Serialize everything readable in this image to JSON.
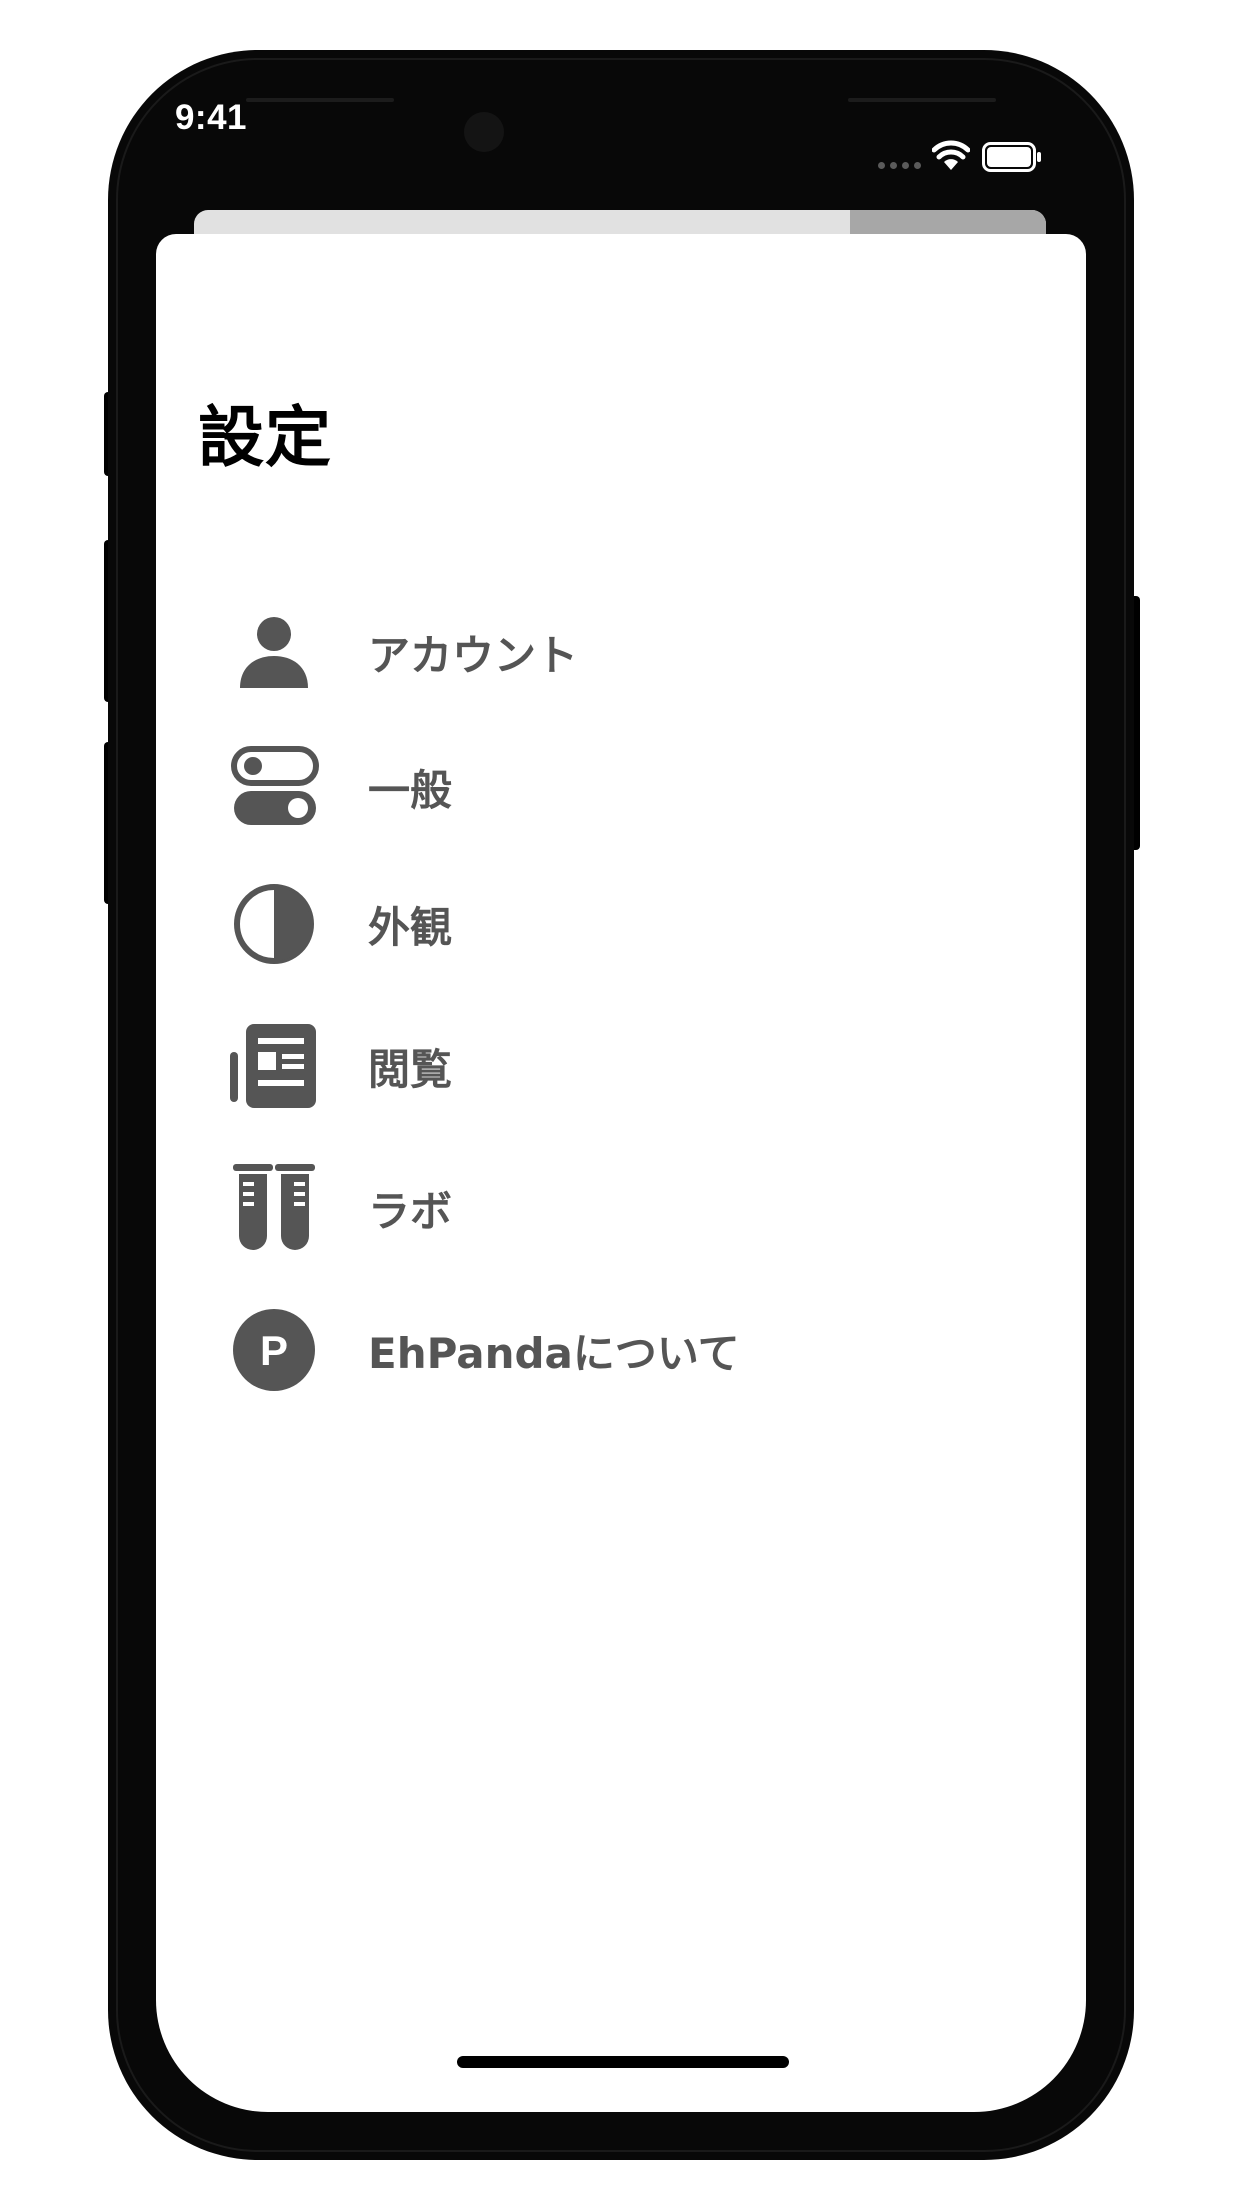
{
  "status_bar": {
    "time": "9:41"
  },
  "screen": {
    "title": "設定"
  },
  "settings": {
    "items": [
      {
        "label": "アカウント",
        "icon": "person-icon"
      },
      {
        "label": "一般",
        "icon": "switches-icon"
      },
      {
        "label": "外観",
        "icon": "appearance-half-circle-icon"
      },
      {
        "label": "閲覧",
        "icon": "newspaper-icon"
      },
      {
        "label": "ラボ",
        "icon": "test-tubes-icon"
      },
      {
        "label": "EhPandaについて",
        "icon": "p-circle-icon"
      }
    ]
  },
  "colors": {
    "icon_gray": "#555555",
    "label_gray": "#555555",
    "title": "#000000",
    "device": "#080808",
    "background": "#ffffff"
  }
}
